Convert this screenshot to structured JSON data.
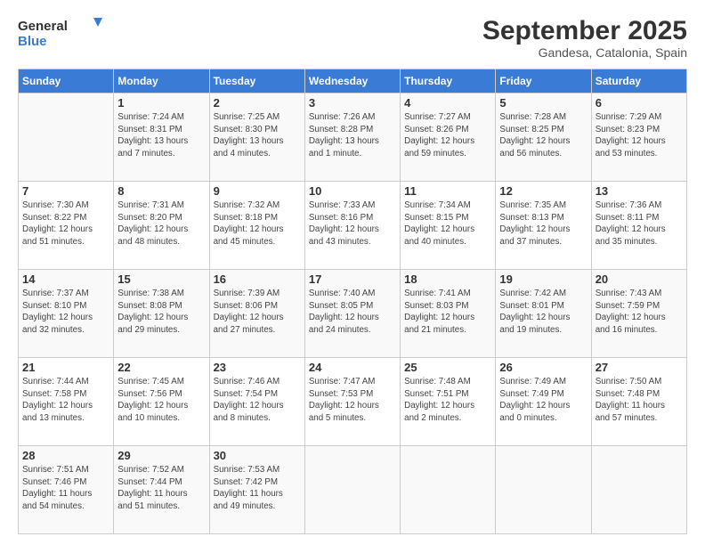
{
  "logo": {
    "general": "General",
    "blue": "Blue"
  },
  "title": "September 2025",
  "subtitle": "Gandesa, Catalonia, Spain",
  "headers": [
    "Sunday",
    "Monday",
    "Tuesday",
    "Wednesday",
    "Thursday",
    "Friday",
    "Saturday"
  ],
  "weeks": [
    [
      {
        "date": "",
        "info": ""
      },
      {
        "date": "1",
        "info": "Sunrise: 7:24 AM\nSunset: 8:31 PM\nDaylight: 13 hours\nand 7 minutes."
      },
      {
        "date": "2",
        "info": "Sunrise: 7:25 AM\nSunset: 8:30 PM\nDaylight: 13 hours\nand 4 minutes."
      },
      {
        "date": "3",
        "info": "Sunrise: 7:26 AM\nSunset: 8:28 PM\nDaylight: 13 hours\nand 1 minute."
      },
      {
        "date": "4",
        "info": "Sunrise: 7:27 AM\nSunset: 8:26 PM\nDaylight: 12 hours\nand 59 minutes."
      },
      {
        "date": "5",
        "info": "Sunrise: 7:28 AM\nSunset: 8:25 PM\nDaylight: 12 hours\nand 56 minutes."
      },
      {
        "date": "6",
        "info": "Sunrise: 7:29 AM\nSunset: 8:23 PM\nDaylight: 12 hours\nand 53 minutes."
      }
    ],
    [
      {
        "date": "7",
        "info": "Sunrise: 7:30 AM\nSunset: 8:22 PM\nDaylight: 12 hours\nand 51 minutes."
      },
      {
        "date": "8",
        "info": "Sunrise: 7:31 AM\nSunset: 8:20 PM\nDaylight: 12 hours\nand 48 minutes."
      },
      {
        "date": "9",
        "info": "Sunrise: 7:32 AM\nSunset: 8:18 PM\nDaylight: 12 hours\nand 45 minutes."
      },
      {
        "date": "10",
        "info": "Sunrise: 7:33 AM\nSunset: 8:16 PM\nDaylight: 12 hours\nand 43 minutes."
      },
      {
        "date": "11",
        "info": "Sunrise: 7:34 AM\nSunset: 8:15 PM\nDaylight: 12 hours\nand 40 minutes."
      },
      {
        "date": "12",
        "info": "Sunrise: 7:35 AM\nSunset: 8:13 PM\nDaylight: 12 hours\nand 37 minutes."
      },
      {
        "date": "13",
        "info": "Sunrise: 7:36 AM\nSunset: 8:11 PM\nDaylight: 12 hours\nand 35 minutes."
      }
    ],
    [
      {
        "date": "14",
        "info": "Sunrise: 7:37 AM\nSunset: 8:10 PM\nDaylight: 12 hours\nand 32 minutes."
      },
      {
        "date": "15",
        "info": "Sunrise: 7:38 AM\nSunset: 8:08 PM\nDaylight: 12 hours\nand 29 minutes."
      },
      {
        "date": "16",
        "info": "Sunrise: 7:39 AM\nSunset: 8:06 PM\nDaylight: 12 hours\nand 27 minutes."
      },
      {
        "date": "17",
        "info": "Sunrise: 7:40 AM\nSunset: 8:05 PM\nDaylight: 12 hours\nand 24 minutes."
      },
      {
        "date": "18",
        "info": "Sunrise: 7:41 AM\nSunset: 8:03 PM\nDaylight: 12 hours\nand 21 minutes."
      },
      {
        "date": "19",
        "info": "Sunrise: 7:42 AM\nSunset: 8:01 PM\nDaylight: 12 hours\nand 19 minutes."
      },
      {
        "date": "20",
        "info": "Sunrise: 7:43 AM\nSunset: 7:59 PM\nDaylight: 12 hours\nand 16 minutes."
      }
    ],
    [
      {
        "date": "21",
        "info": "Sunrise: 7:44 AM\nSunset: 7:58 PM\nDaylight: 12 hours\nand 13 minutes."
      },
      {
        "date": "22",
        "info": "Sunrise: 7:45 AM\nSunset: 7:56 PM\nDaylight: 12 hours\nand 10 minutes."
      },
      {
        "date": "23",
        "info": "Sunrise: 7:46 AM\nSunset: 7:54 PM\nDaylight: 12 hours\nand 8 minutes."
      },
      {
        "date": "24",
        "info": "Sunrise: 7:47 AM\nSunset: 7:53 PM\nDaylight: 12 hours\nand 5 minutes."
      },
      {
        "date": "25",
        "info": "Sunrise: 7:48 AM\nSunset: 7:51 PM\nDaylight: 12 hours\nand 2 minutes."
      },
      {
        "date": "26",
        "info": "Sunrise: 7:49 AM\nSunset: 7:49 PM\nDaylight: 12 hours\nand 0 minutes."
      },
      {
        "date": "27",
        "info": "Sunrise: 7:50 AM\nSunset: 7:48 PM\nDaylight: 11 hours\nand 57 minutes."
      }
    ],
    [
      {
        "date": "28",
        "info": "Sunrise: 7:51 AM\nSunset: 7:46 PM\nDaylight: 11 hours\nand 54 minutes."
      },
      {
        "date": "29",
        "info": "Sunrise: 7:52 AM\nSunset: 7:44 PM\nDaylight: 11 hours\nand 51 minutes."
      },
      {
        "date": "30",
        "info": "Sunrise: 7:53 AM\nSunset: 7:42 PM\nDaylight: 11 hours\nand 49 minutes."
      },
      {
        "date": "",
        "info": ""
      },
      {
        "date": "",
        "info": ""
      },
      {
        "date": "",
        "info": ""
      },
      {
        "date": "",
        "info": ""
      }
    ]
  ]
}
